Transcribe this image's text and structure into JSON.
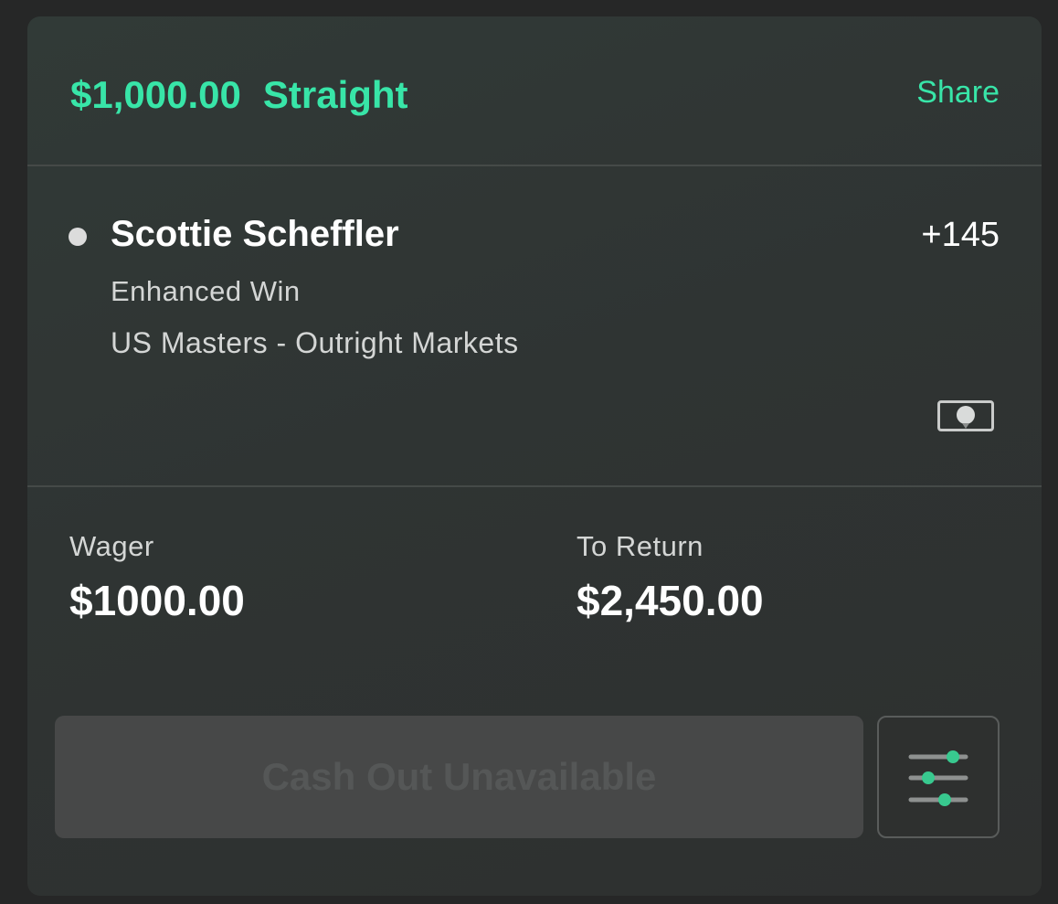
{
  "header": {
    "amount": "$1,000.00",
    "bet_type": "Straight",
    "share_label": "Share"
  },
  "selection": {
    "name": "Scottie Scheffler",
    "odds": "+145",
    "market": "Enhanced Win",
    "event": "US Masters - Outright Markets",
    "sport_icon": "golf-ball-tee-icon"
  },
  "summary": {
    "wager_label": "Wager",
    "wager_value": "$1000.00",
    "return_label": "To Return",
    "return_value": "$2,450.00"
  },
  "actions": {
    "cashout_label": "Cash Out Unavailable",
    "settings_icon": "sliders-icon"
  },
  "colors": {
    "accent": "#38e5a8",
    "card_bg": "#2f3433",
    "page_bg": "#262727",
    "disabled_button": "#474848"
  }
}
